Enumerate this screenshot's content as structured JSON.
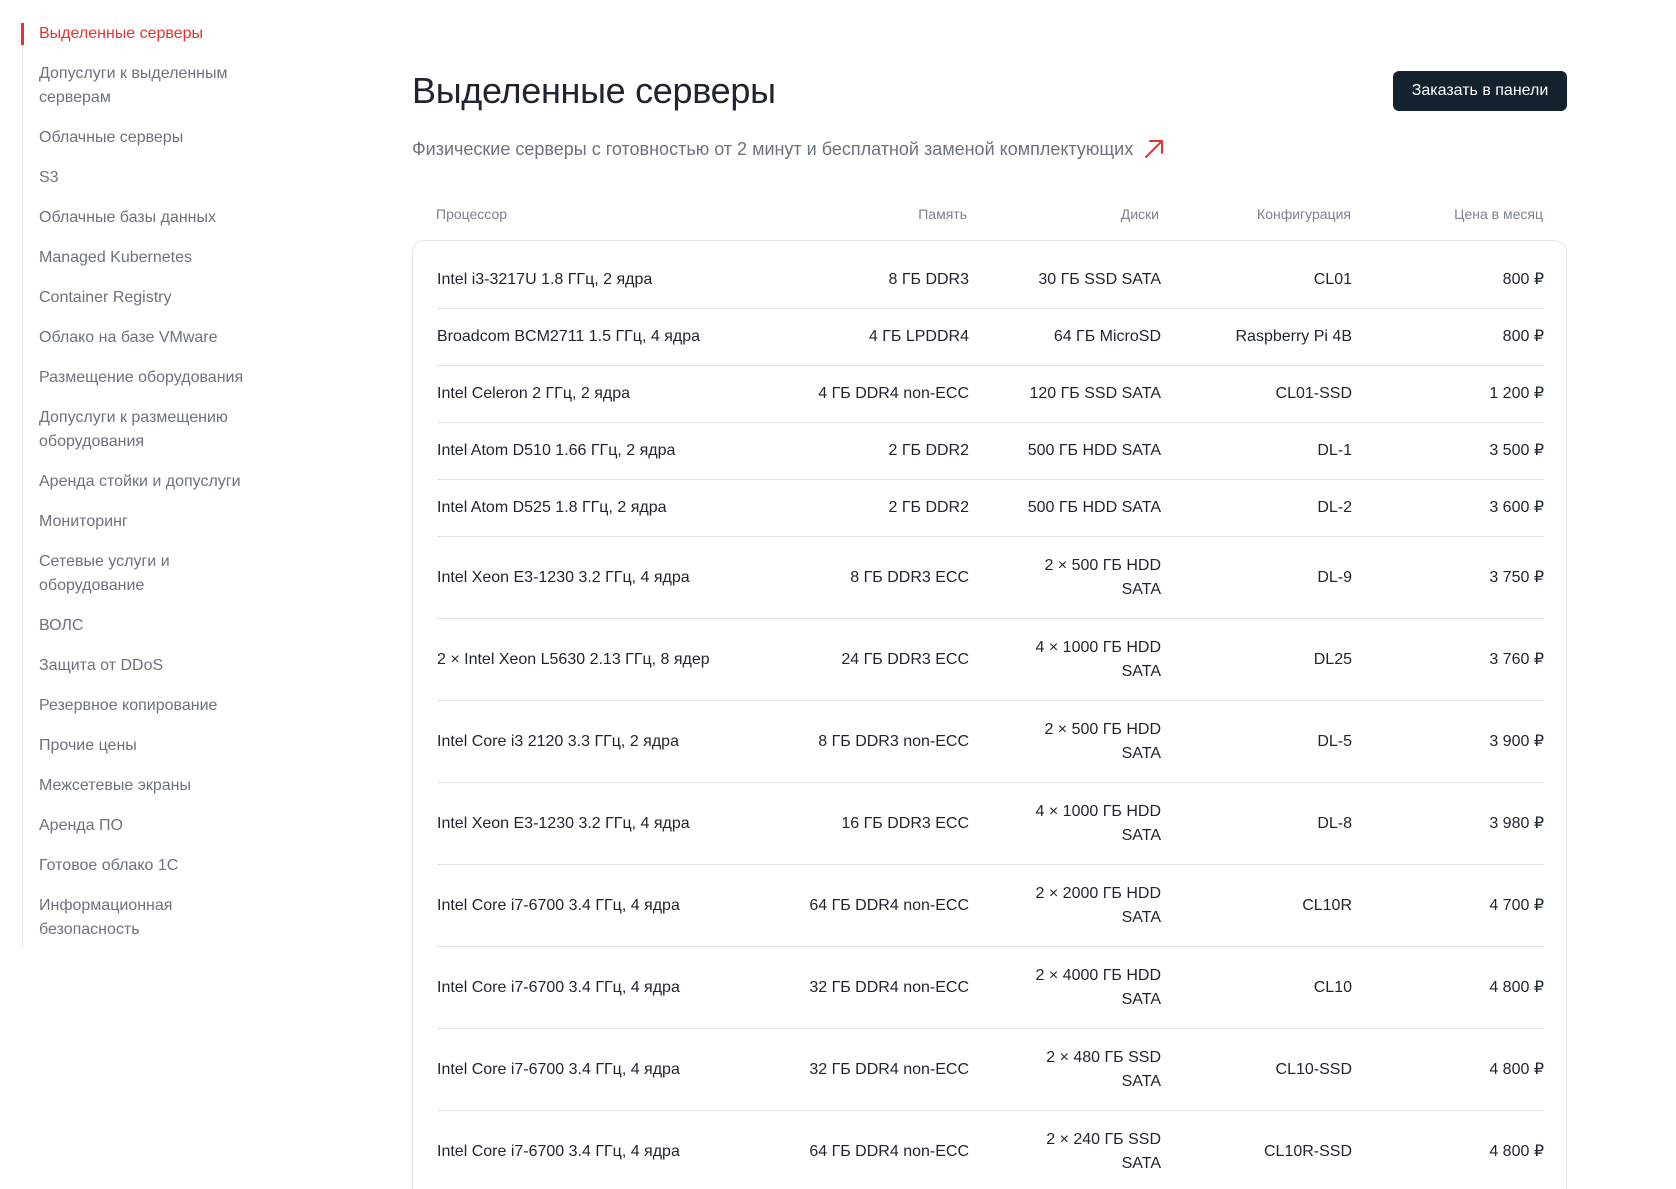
{
  "sidebar": {
    "items": [
      {
        "label": "Выделенные серверы",
        "active": true
      },
      {
        "label": "Допуслуги к выделенным серверам"
      },
      {
        "label": "Облачные серверы"
      },
      {
        "label": "S3"
      },
      {
        "label": "Облачные базы данных"
      },
      {
        "label": "Managed Kubernetes"
      },
      {
        "label": "Container Registry"
      },
      {
        "label": "Облако на базе VMware"
      },
      {
        "label": "Размещение оборудования"
      },
      {
        "label": "Допуслуги к размещению оборудования"
      },
      {
        "label": "Аренда стойки и допуслуги"
      },
      {
        "label": "Мониторинг"
      },
      {
        "label": "Сетевые услуги и оборудование"
      },
      {
        "label": "ВОЛС"
      },
      {
        "label": "Защита от DDoS"
      },
      {
        "label": "Резервное копирование"
      },
      {
        "label": "Прочие цены"
      },
      {
        "label": "Межсетевые экраны"
      },
      {
        "label": "Аренда ПО"
      },
      {
        "label": "Готовое облако 1С"
      },
      {
        "label": "Информационная безопасность"
      }
    ]
  },
  "header": {
    "title": "Выделенные серверы",
    "order_button": "Заказать в панели",
    "subtitle": "Физические серверы с готовностью от 2 минут и бесплатной заменой комплектующих",
    "accent_color": "#e3342f"
  },
  "table": {
    "columns": {
      "cpu": "Процессор",
      "memory": "Память",
      "disks": "Диски",
      "config": "Конфигурация",
      "price": "Цена в месяц"
    },
    "rows": [
      {
        "cpu": "Intel i3-3217U 1.8 ГГц, 2 ядра",
        "memory": "8 ГБ DDR3",
        "disks": "30 ГБ SSD SATA",
        "config": "CL01",
        "price": "800 ₽"
      },
      {
        "cpu": "Broadcom BCM2711 1.5 ГГц, 4 ядра",
        "memory": "4 ГБ LPDDR4",
        "disks": "64 ГБ MicroSD",
        "config": "Raspberry Pi 4B",
        "price": "800 ₽"
      },
      {
        "cpu": "Intel Celeron 2 ГГц, 2 ядра",
        "memory": "4 ГБ DDR4 non-ECC",
        "disks": "120 ГБ SSD SATA",
        "config": "CL01-SSD",
        "price": "1 200 ₽"
      },
      {
        "cpu": "Intel Atom D510 1.66 ГГц, 2 ядра",
        "memory": "2 ГБ DDR2",
        "disks": "500 ГБ HDD SATA",
        "config": "DL-1",
        "price": "3 500 ₽"
      },
      {
        "cpu": "Intel Atom D525 1.8 ГГц, 2 ядра",
        "memory": "2 ГБ DDR2",
        "disks": "500 ГБ HDD SATA",
        "config": "DL-2",
        "price": "3 600 ₽"
      },
      {
        "cpu": "Intel Xeon E3-1230 3.2 ГГц, 4 ядра",
        "memory": "8 ГБ DDR3 ECC",
        "disks": "2 × 500 ГБ HDD SATA",
        "config": "DL-9",
        "price": "3 750 ₽"
      },
      {
        "cpu": "2 × Intel Xeon L5630 2.13 ГГц, 8 ядер",
        "memory": "24 ГБ DDR3 ECC",
        "disks": "4 × 1000 ГБ HDD SATA",
        "config": "DL25",
        "price": "3 760 ₽"
      },
      {
        "cpu": "Intel Core i3 2120 3.3 ГГц, 2 ядра",
        "memory": "8 ГБ DDR3 non-ECC",
        "disks": "2 × 500 ГБ HDD SATA",
        "config": "DL-5",
        "price": "3 900 ₽"
      },
      {
        "cpu": "Intel Xeon E3-1230 3.2 ГГц, 4 ядра",
        "memory": "16 ГБ DDR3 ECC",
        "disks": "4 × 1000 ГБ HDD SATA",
        "config": "DL-8",
        "price": "3 980 ₽"
      },
      {
        "cpu": "Intel Core i7-6700 3.4 ГГц, 4 ядра",
        "memory": "64 ГБ DDR4 non-ECC",
        "disks": "2 × 2000 ГБ HDD SATA",
        "config": "CL10R",
        "price": "4 700 ₽"
      },
      {
        "cpu": "Intel Core i7-6700 3.4 ГГц, 4 ядра",
        "memory": "32 ГБ DDR4 non-ECC",
        "disks": "2 × 4000 ГБ HDD SATA",
        "config": "CL10",
        "price": "4 800 ₽"
      },
      {
        "cpu": "Intel Core i7-6700 3.4 ГГц, 4 ядра",
        "memory": "32 ГБ DDR4 non-ECC",
        "disks": "2 × 480 ГБ SSD SATA",
        "config": "CL10-SSD",
        "price": "4 800 ₽"
      },
      {
        "cpu": "Intel Core i7-6700 3.4 ГГц, 4 ядра",
        "memory": "64 ГБ DDR4 non-ECC",
        "disks": "2 × 240 ГБ SSD SATA",
        "config": "CL10R-SSD",
        "price": "4 800 ₽"
      }
    ]
  }
}
